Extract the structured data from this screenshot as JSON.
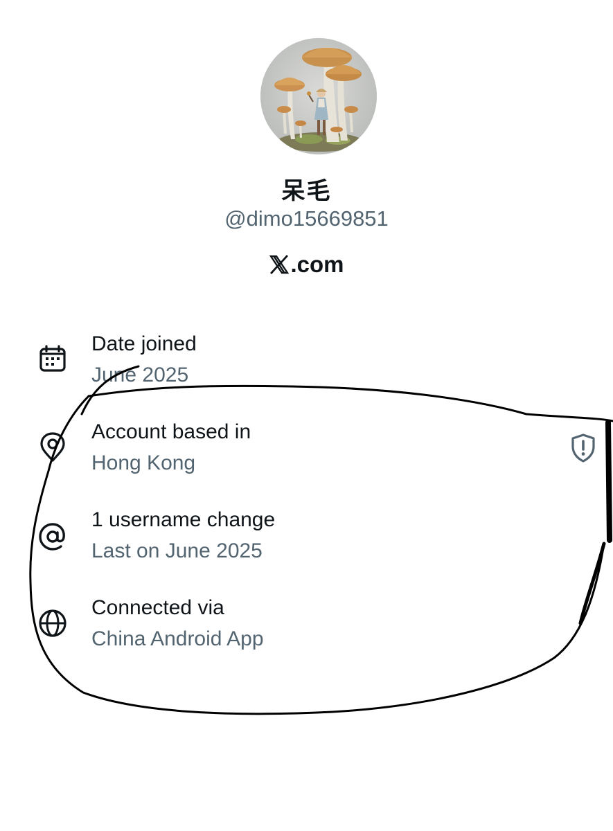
{
  "profile": {
    "display_name": "呆毛",
    "handle": "@dimo15669851",
    "site": ".com",
    "avatar_icon": "mushroom-illustration-avatar"
  },
  "about": {
    "rows": [
      {
        "icon": "calendar-icon",
        "title": "Date joined",
        "value": "June 2025"
      },
      {
        "icon": "location-pin-icon",
        "title": "Account based in",
        "value": "Hong Kong"
      },
      {
        "icon": "at-sign-icon",
        "title": "1 username change",
        "value": "Last on June 2025"
      },
      {
        "icon": "globe-icon",
        "title": "Connected via",
        "value": "China Android App"
      }
    ],
    "location_badge_icon": "shield-exclamation-icon"
  },
  "colors": {
    "text_primary": "#0f1419",
    "text_secondary": "#536471",
    "background": "#ffffff",
    "annotation_ink": "#000000"
  }
}
